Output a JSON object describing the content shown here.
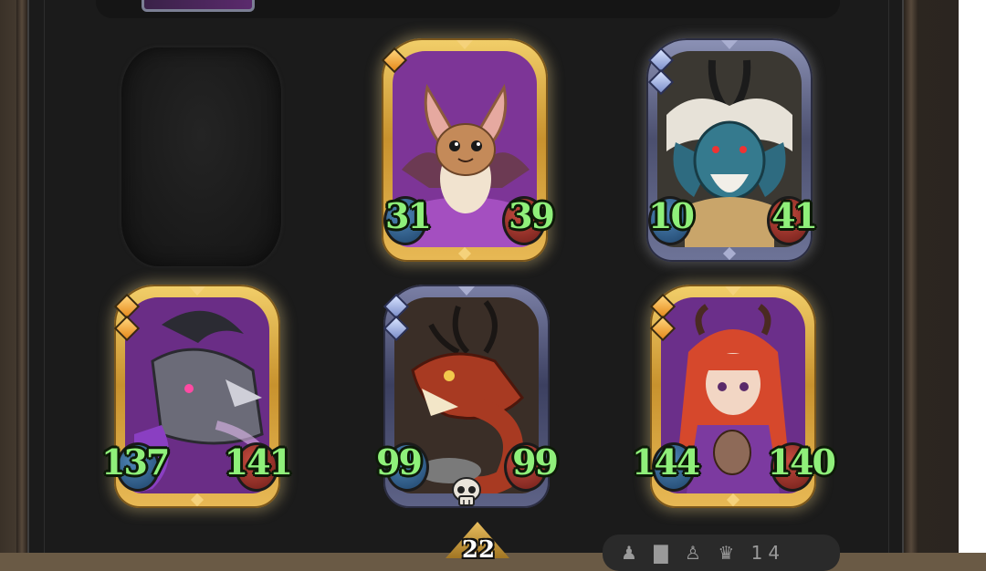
{
  "board": {
    "empty_slot": "empty-minion-slot",
    "cards": [
      {
        "id": "bat",
        "tier": "gold",
        "gems": [
          "orange"
        ],
        "attack": "31",
        "health": "39",
        "portrait_colors": [
          "#8e3fa8",
          "#c78d57",
          "#f0d4b2"
        ]
      },
      {
        "id": "frost-dragon",
        "tier": "silver",
        "gems": [
          "blue",
          "blue"
        ],
        "attack": "10",
        "health": "41",
        "portrait_colors": [
          "#3c3a34",
          "#2f6f86",
          "#e9e4dc"
        ]
      },
      {
        "id": "shadow-dragon",
        "tier": "gold",
        "gems": [
          "orange",
          "orange"
        ],
        "attack": "137",
        "health": "141",
        "portrait_colors": [
          "#6a2d86",
          "#4a4a55",
          "#cfcfd8"
        ]
      },
      {
        "id": "fire-dragon",
        "tier": "silver-plain",
        "gems": [
          "blue",
          "blue"
        ],
        "attack": "99",
        "health": "99",
        "portrait_colors": [
          "#3a2c26",
          "#a23a22",
          "#e3c9a0"
        ]
      },
      {
        "id": "dragon-girl",
        "tier": "gold",
        "gems": [
          "orange",
          "orange"
        ],
        "attack": "144",
        "health": "140",
        "portrait_colors": [
          "#6b2f8a",
          "#d6482c",
          "#f2d6c4"
        ]
      }
    ],
    "marker_icon": "skull-icon",
    "bottom_count": "22",
    "bottom_panel_text": "♟ ▇ ♙ ♛ 14"
  },
  "colors": {
    "stat_text": "#8ff07a",
    "gold_frame": "#e0aa44",
    "silver_frame": "#6e7498",
    "attack_orb": "#2f5f8d",
    "health_orb": "#a3342b"
  }
}
